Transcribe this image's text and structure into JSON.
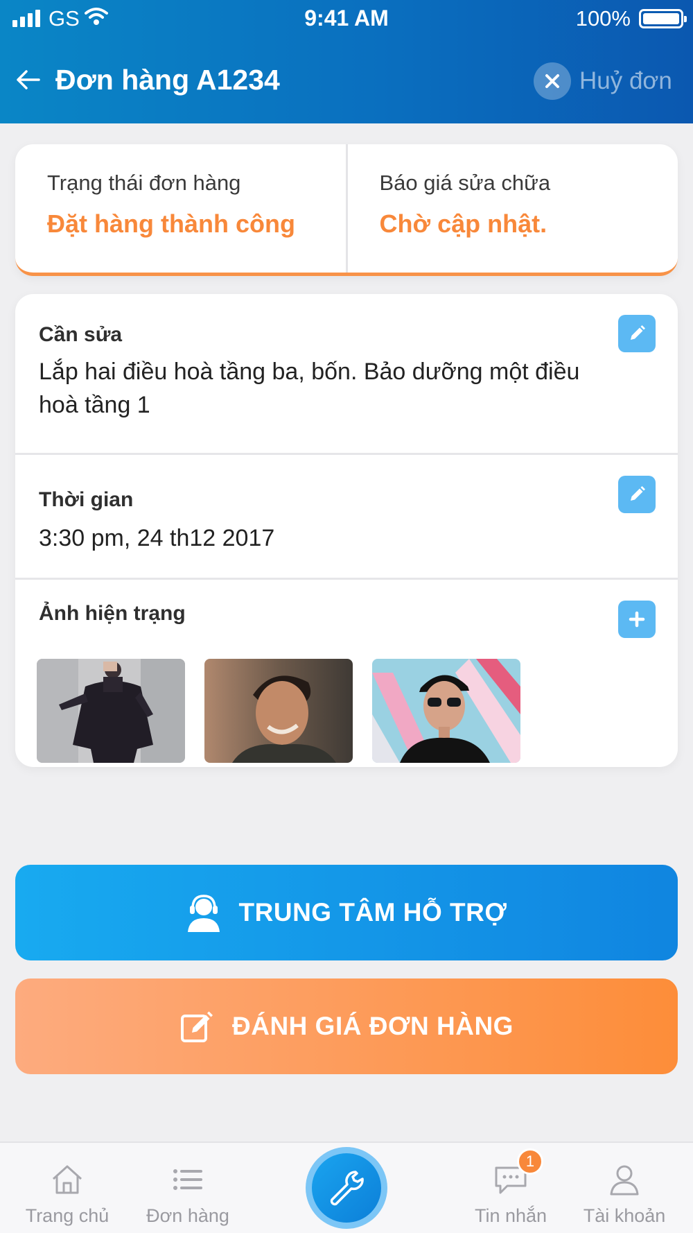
{
  "status_bar": {
    "carrier": "GS",
    "time": "9:41 AM",
    "battery": "100%",
    "battery_level": 1.0
  },
  "nav": {
    "back_icon": "arrow-left-icon",
    "title": "Đơn hàng A1234",
    "cancel_label": "Huỷ đơn"
  },
  "status_card": {
    "order_status_label": "Trạng thái đơn hàng",
    "order_status_value": "Đặt hàng thành công",
    "quote_label": "Báo giá sửa chữa",
    "quote_value": "Chờ cập nhật."
  },
  "details": {
    "need": {
      "title": "Cần sửa",
      "text": "Lắp hai điều hoà tầng ba, bốn. Bảo dưỡng một điều hoà tầng 1"
    },
    "time": {
      "title": "Thời gian",
      "value": "3:30 pm,  24 th12 2017"
    },
    "photos": {
      "title": "Ảnh hiện trạng",
      "items": [
        "photo-woman-black-dress",
        "photo-smiling-man",
        "photo-man-sunglasses"
      ]
    }
  },
  "actions": {
    "support": "TRUNG TÂM HỖ TRỢ",
    "rate": "ĐÁNH GIÁ ĐƠN HÀNG"
  },
  "tabbar": {
    "home": "Trang chủ",
    "orders": "Đơn hàng",
    "messages": "Tin nhắn",
    "messages_badge": "1",
    "account": "Tài khoản"
  },
  "colors": {
    "header": "#0a74c2",
    "accent_orange": "#f8883a",
    "accent_blue": "#1aa4ef"
  }
}
